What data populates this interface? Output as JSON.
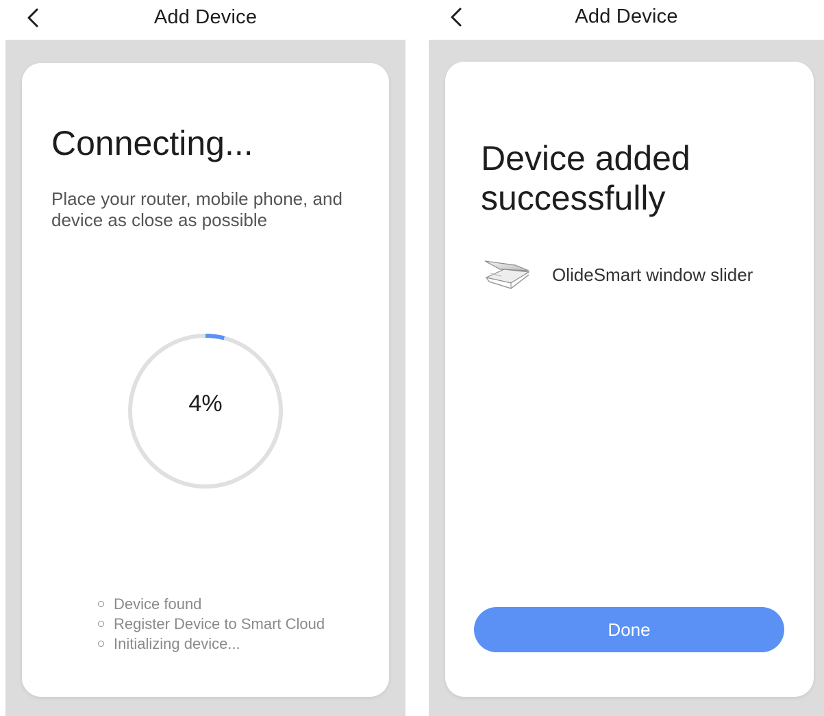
{
  "left_screen": {
    "header": {
      "title": "Add Device",
      "back_icon": "chevron-left-icon"
    },
    "title": "Connecting...",
    "subtitle": "Place your router, mobile phone, and device as close as possible",
    "progress": {
      "percent": 4,
      "label": "4%",
      "track_color": "#e0e0e0",
      "fill_color": "#5b91f5"
    },
    "steps": [
      "Device found",
      "Register Device to Smart Cloud",
      "Initializing device..."
    ]
  },
  "right_screen": {
    "header": {
      "title": "Add Device",
      "back_icon": "chevron-left-icon"
    },
    "title": "Device added successfully",
    "device": {
      "name": "OlideSmart window slider",
      "icon": "window-slider-icon"
    },
    "done_label": "Done",
    "accent_color": "#5b91f5"
  }
}
